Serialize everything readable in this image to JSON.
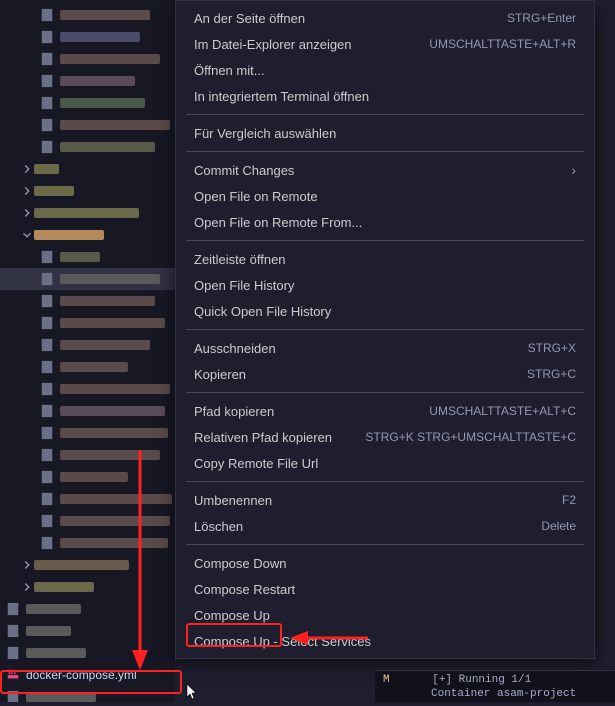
{
  "sidebar": {
    "docker_compose_file": "docker-compose.yml"
  },
  "contextMenu": {
    "groups": [
      {
        "items": [
          {
            "label": "An der Seite öffnen",
            "shortcut": "STRG+Enter"
          },
          {
            "label": "Im Datei-Explorer anzeigen",
            "shortcut": "UMSCHALTTASTE+ALT+R"
          },
          {
            "label": "Öffnen mit...",
            "shortcut": ""
          },
          {
            "label": "In integriertem Terminal öffnen",
            "shortcut": ""
          }
        ]
      },
      {
        "items": [
          {
            "label": "Für Vergleich auswählen",
            "shortcut": ""
          }
        ]
      },
      {
        "items": [
          {
            "label": "Commit Changes",
            "shortcut": "",
            "submenu": true
          },
          {
            "label": "Open File on Remote",
            "shortcut": ""
          },
          {
            "label": "Open File on Remote From...",
            "shortcut": ""
          }
        ]
      },
      {
        "items": [
          {
            "label": "Zeitleiste öffnen",
            "shortcut": ""
          },
          {
            "label": "Open File History",
            "shortcut": ""
          },
          {
            "label": "Quick Open File History",
            "shortcut": ""
          }
        ]
      },
      {
        "items": [
          {
            "label": "Ausschneiden",
            "shortcut": "STRG+X"
          },
          {
            "label": "Kopieren",
            "shortcut": "STRG+C"
          }
        ]
      },
      {
        "items": [
          {
            "label": "Pfad kopieren",
            "shortcut": "UMSCHALTTASTE+ALT+C"
          },
          {
            "label": "Relativen Pfad kopieren",
            "shortcut": "STRG+K STRG+UMSCHALTTASTE+C"
          },
          {
            "label": "Copy Remote File Url",
            "shortcut": ""
          }
        ]
      },
      {
        "items": [
          {
            "label": "Umbenennen",
            "shortcut": "F2"
          },
          {
            "label": "Löschen",
            "shortcut": "Delete"
          }
        ]
      },
      {
        "items": [
          {
            "label": "Compose Down",
            "shortcut": ""
          },
          {
            "label": "Compose Restart",
            "shortcut": ""
          },
          {
            "label": "Compose Up",
            "shortcut": ""
          },
          {
            "label": "Compose Up - Select Services",
            "shortcut": ""
          }
        ]
      }
    ]
  },
  "terminal": {
    "m_badge": "M",
    "line1": "[+] Running 1/1",
    "line2": "Container asam-project"
  }
}
